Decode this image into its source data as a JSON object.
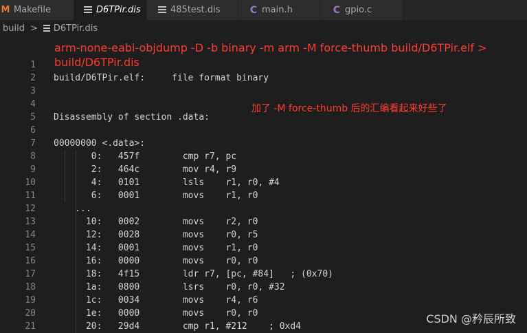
{
  "tabs": [
    {
      "label": "Makefile",
      "icon": "makefile-icon",
      "active": false
    },
    {
      "label": "D6TPir.dis",
      "icon": "lines-icon",
      "active": true
    },
    {
      "label": "485test.dis",
      "icon": "lines-icon",
      "active": false
    },
    {
      "label": "main.h",
      "icon": "c-icon",
      "active": false
    },
    {
      "label": "gpio.c",
      "icon": "c-icon",
      "active": false
    }
  ],
  "breadcrumb": {
    "folder": "build",
    "separator": ">",
    "file": "D6TPir.dis"
  },
  "annotations": {
    "command": "arm-none-eabi-objdump -D -b binary -m arm -M force-thumb build/D6TPir.elf > build/D6TPir.dis",
    "note": "加了 -M force-thumb 后的汇编看起来好些了",
    "color": "#ff3b30"
  },
  "code_lines": [
    {
      "n": "1",
      "text": ""
    },
    {
      "n": "2",
      "text": "build/D6TPir.elf:     file format binary"
    },
    {
      "n": "3",
      "text": ""
    },
    {
      "n": "4",
      "text": ""
    },
    {
      "n": "5",
      "text": "Disassembly of section .data:"
    },
    {
      "n": "6",
      "text": ""
    },
    {
      "n": "7",
      "text": "00000000 <.data>:"
    },
    {
      "n": "8",
      "text": "       0:   457f        cmp r7, pc"
    },
    {
      "n": "9",
      "text": "       2:   464c        mov r4, r9"
    },
    {
      "n": "10",
      "text": "       4:   0101        lsls    r1, r0, #4"
    },
    {
      "n": "11",
      "text": "       6:   0001        movs    r1, r0"
    },
    {
      "n": "12",
      "text": "    ..."
    },
    {
      "n": "13",
      "text": "      10:   0002        movs    r2, r0"
    },
    {
      "n": "14",
      "text": "      12:   0028        movs    r0, r5"
    },
    {
      "n": "15",
      "text": "      14:   0001        movs    r1, r0"
    },
    {
      "n": "16",
      "text": "      16:   0000        movs    r0, r0"
    },
    {
      "n": "17",
      "text": "      18:   4f15        ldr r7, [pc, #84]   ; (0x70)"
    },
    {
      "n": "18",
      "text": "      1a:   0800        lsrs    r0, r0, #32"
    },
    {
      "n": "19",
      "text": "      1c:   0034        movs    r4, r6"
    },
    {
      "n": "20",
      "text": "      1e:   0000        movs    r0, r0"
    },
    {
      "n": "21",
      "text": "      20:   29d4        cmp r1, #212    ; 0xd4"
    }
  ],
  "watermark": "CSDN @矜辰所致",
  "colors": {
    "editor_bg": "#1e1e1e",
    "tab_bg": "#2d2d2d",
    "line_number": "#858585",
    "code_text": "#d4d4d4",
    "makefile_icon": "#e37933",
    "c_icon": "#a074c4"
  }
}
